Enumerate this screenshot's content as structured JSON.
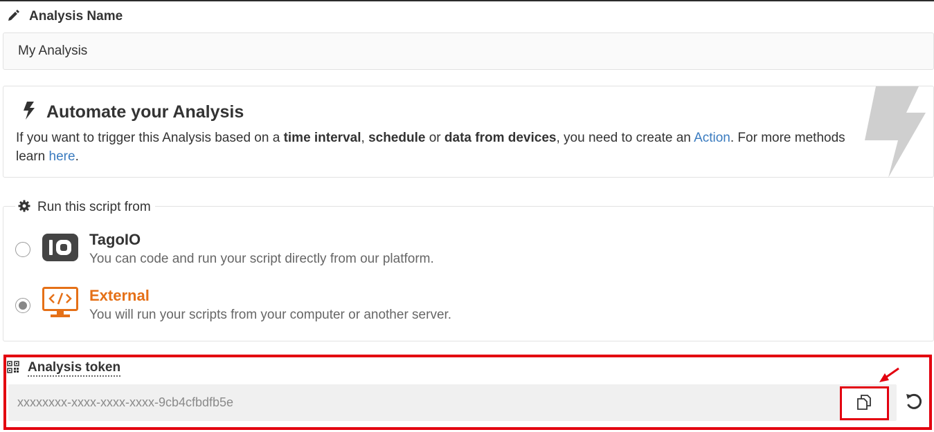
{
  "analysis_name": {
    "label": "Analysis Name",
    "value": "My Analysis",
    "icon": "pencil-icon"
  },
  "automate": {
    "title": "Automate your Analysis",
    "icon": "bolt-icon",
    "text_parts": {
      "p1": "If you want to trigger this Analysis based on a ",
      "b1": "time interval",
      "p2": ", ",
      "b2": "schedule",
      "p3": " or ",
      "b3": "data from devices",
      "p4": ", you need to create an ",
      "link_action": "Action",
      "p5": ". For more methods learn ",
      "link_here": "here",
      "p6": "."
    },
    "link_color": "#3a7bbf"
  },
  "run_from": {
    "legend": "Run this script from",
    "icon": "gear-icon",
    "options": [
      {
        "title": "TagoIO",
        "description": "You can code and run your script directly from our platform.",
        "selected": false,
        "icon": "tagoio-logo-icon"
      },
      {
        "title": "External",
        "description": "You will run your scripts from your computer or another server.",
        "selected": true,
        "icon": "external-monitor-icon"
      }
    ],
    "accent_color": "#e57017"
  },
  "token": {
    "label": "Analysis token",
    "icon": "qr-code-icon",
    "value": "xxxxxxxx-xxxx-xxxx-xxxx-9cb4cfbdfb5e",
    "copy_icon": "copy-icon",
    "reset_icon": "refresh-icon",
    "highlight_color": "#e3000f"
  }
}
